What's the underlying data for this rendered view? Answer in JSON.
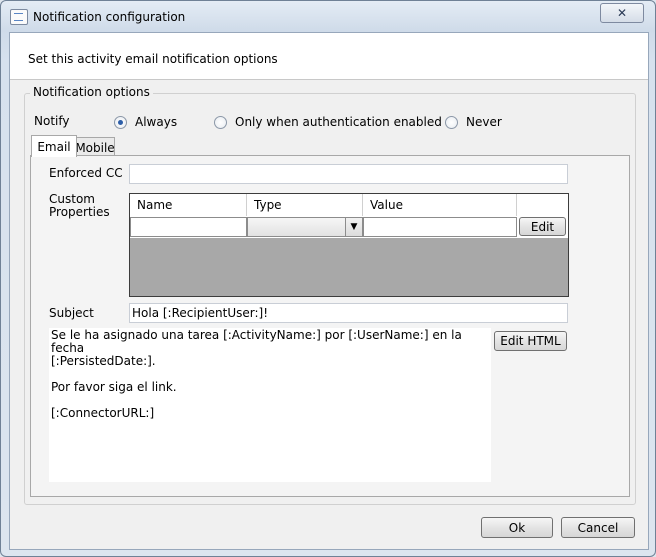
{
  "window": {
    "title": "Notification configuration",
    "close_glyph": "✕"
  },
  "header": {
    "text": "Set this activity email notification options"
  },
  "group": {
    "legend": "Notification options"
  },
  "notify": {
    "label": "Notify",
    "options": [
      {
        "label": "Always",
        "selected": true
      },
      {
        "label": "Only when authentication enabled",
        "selected": false
      },
      {
        "label": "Never",
        "selected": false
      }
    ]
  },
  "tabs": [
    {
      "label": "Email",
      "active": true
    },
    {
      "label": "Mobile",
      "active": false
    }
  ],
  "email": {
    "enforced_cc_label": "Enforced CC",
    "enforced_cc_value": "",
    "custom_properties_label": "Custom\nProperties",
    "grid": {
      "columns": [
        "Name",
        "Type",
        "Value"
      ],
      "row": {
        "name": "",
        "type": "",
        "value": ""
      },
      "edit_button": "Edit"
    },
    "subject_label": "Subject",
    "subject_value": "Hola [:RecipientUser:]!",
    "body": "Se le ha asignado una tarea [:ActivityName:] por [:UserName:] en la fecha\n[:PersistedDate:].\n\nPor favor siga el link.\n\n[:ConnectorURL:]",
    "edit_html_button": "Edit HTML"
  },
  "footer": {
    "ok_label": "Ok",
    "cancel_label": "Cancel"
  },
  "icons": {
    "window-icon": "notification-icon",
    "combo-arrow": "▼"
  },
  "colors": {
    "selected_radio": "#2d5ea8",
    "grid_empty_area": "#a8a8a8"
  }
}
